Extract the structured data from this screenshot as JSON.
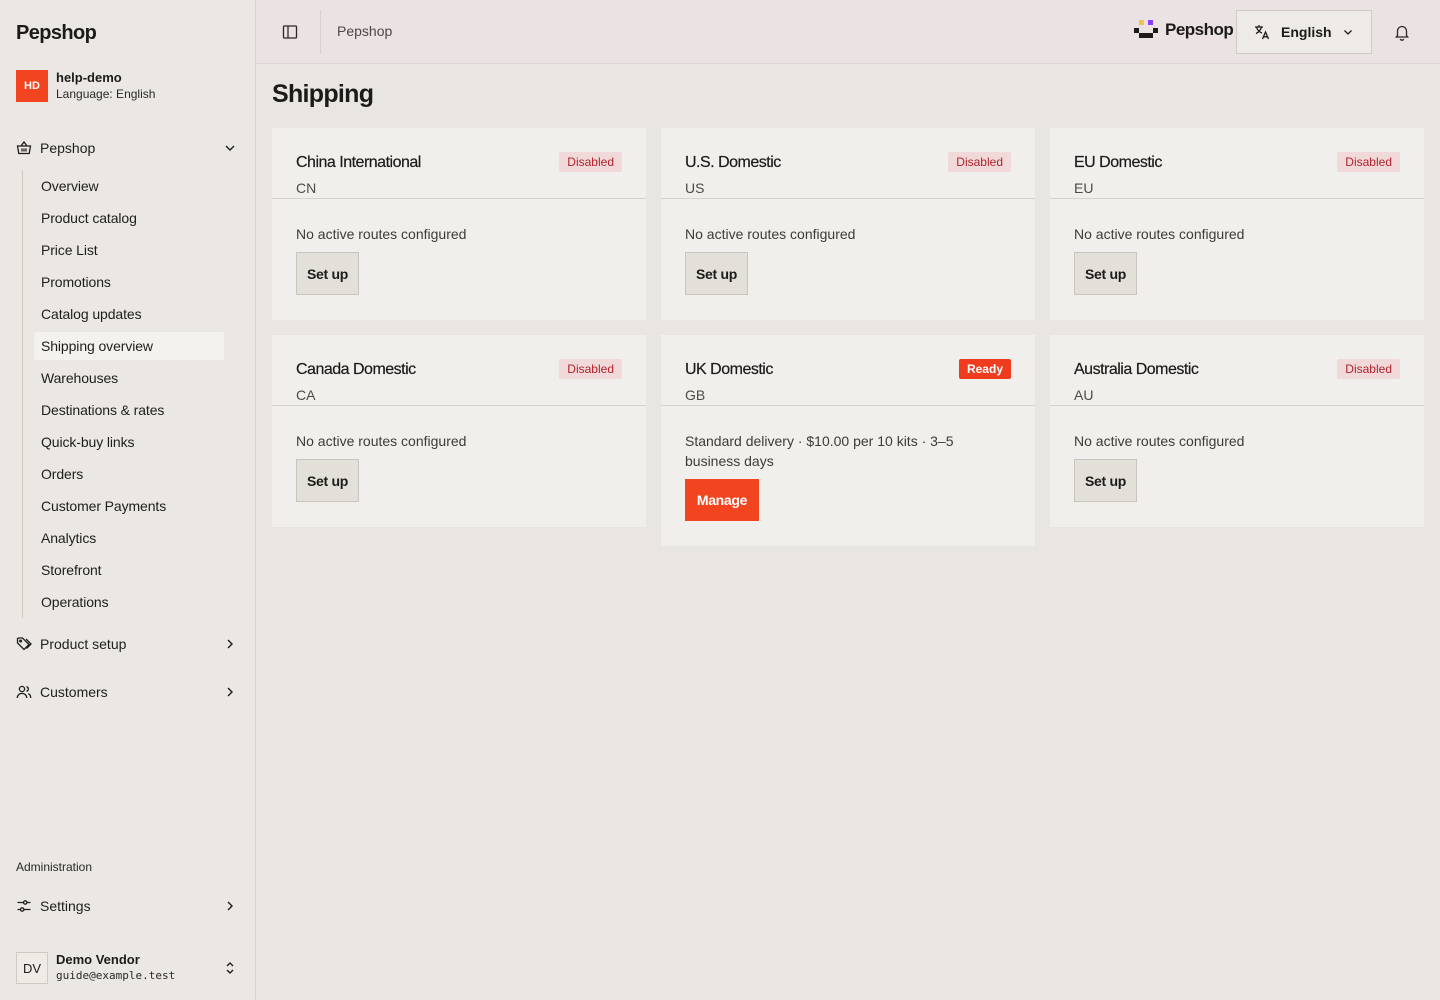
{
  "sidebar": {
    "brand": "Pepshop",
    "account": {
      "initials": "HD",
      "name": "help-demo",
      "language": "Language: English"
    },
    "main_group": {
      "label": "Pepshop",
      "icon": "basket-icon"
    },
    "sub_items": [
      {
        "label": "Overview"
      },
      {
        "label": "Product catalog"
      },
      {
        "label": "Price List"
      },
      {
        "label": "Promotions"
      },
      {
        "label": "Catalog updates"
      },
      {
        "label": "Shipping overview",
        "active": true
      },
      {
        "label": "Warehouses"
      },
      {
        "label": "Destinations & rates"
      },
      {
        "label": "Quick-buy links"
      },
      {
        "label": "Orders"
      },
      {
        "label": "Customer Payments"
      },
      {
        "label": "Analytics"
      },
      {
        "label": "Storefront"
      },
      {
        "label": "Operations"
      }
    ],
    "product_setup": {
      "label": "Product setup",
      "icon": "tag-icon"
    },
    "customers": {
      "label": "Customers",
      "icon": "users-icon"
    },
    "admin_label": "Administration",
    "settings": {
      "label": "Settings",
      "icon": "sliders-icon"
    },
    "user": {
      "initials": "DV",
      "name": "Demo Vendor",
      "email": "guide@example.test"
    }
  },
  "topbar": {
    "breadcrumb": "Pepshop",
    "brand": "Pepshop",
    "language": "English"
  },
  "page": {
    "title": "Shipping"
  },
  "cards": [
    {
      "title": "China International",
      "code": "CN",
      "status": "Disabled",
      "description": "No active routes configured",
      "action": "Set up"
    },
    {
      "title": "U.S. Domestic",
      "code": "US",
      "status": "Disabled",
      "description": "No active routes configured",
      "action": "Set up"
    },
    {
      "title": "EU Domestic",
      "code": "EU",
      "status": "Disabled",
      "description": "No active routes configured",
      "action": "Set up"
    },
    {
      "title": "Canada Domestic",
      "code": "CA",
      "status": "Disabled",
      "description": "No active routes configured",
      "action": "Set up"
    },
    {
      "title": "UK Domestic",
      "code": "GB",
      "status": "Ready",
      "description": "Standard delivery · $10.00 per 10 kits · 3–5 business days",
      "action": "Manage"
    },
    {
      "title": "Australia Domestic",
      "code": "AU",
      "status": "Disabled",
      "description": "No active routes configured",
      "action": "Set up"
    }
  ],
  "colors": {
    "accent": "#f2441f",
    "disabled_badge_bg": "#f2d9d9",
    "disabled_badge_text": "#b0222c",
    "ready_badge_bg": "#ef3b1e"
  }
}
